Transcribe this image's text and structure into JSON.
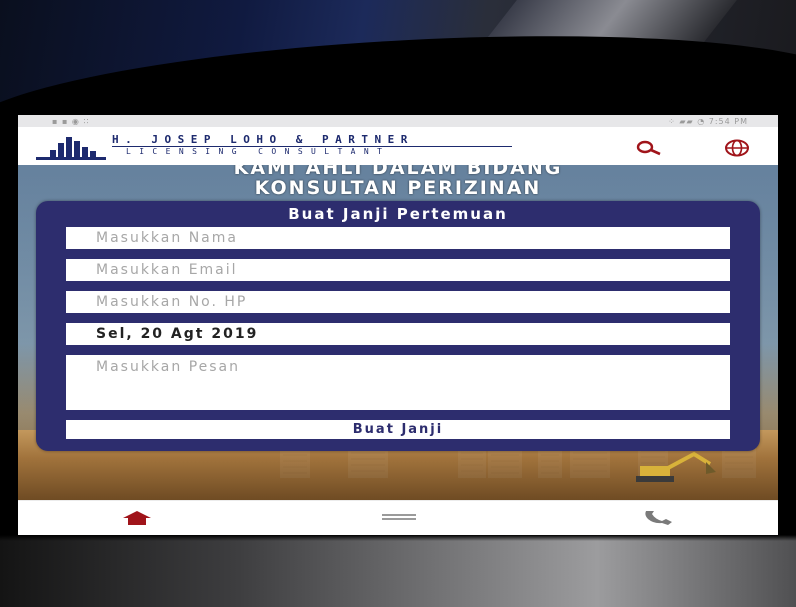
{
  "statusbar": {
    "left": "▪ ▪ ◉ ∶∶",
    "right": "⁘ ▰▰ ◔ 7:54 PM"
  },
  "brand": {
    "line1": "H. JOSEP LOHO & PARTNER",
    "line2": "LICENSING CONSULTANT",
    "color": "#1d2a6e"
  },
  "header_icons": {
    "search": "search-icon",
    "globe": "globe-icon",
    "accent": "#a0141a"
  },
  "hero": {
    "title_line1": "KAMI AHLI DALAM BIDANG",
    "title_line2": "KONSULTAN PERIZINAN"
  },
  "form": {
    "title": "Buat Janji Pertemuan",
    "name_placeholder": "Masukkan Nama",
    "email_placeholder": "Masukkan Email",
    "phone_placeholder": "Masukkan No. HP",
    "date_value": "Sel, 20 Agt 2019",
    "message_placeholder": "Masukkan Pesan",
    "submit_label": "Buat Janji",
    "card_color": "#2d2d6e"
  },
  "bottom_nav": {
    "home": "home-icon",
    "menu": "menu-icon",
    "call": "phone-icon"
  }
}
